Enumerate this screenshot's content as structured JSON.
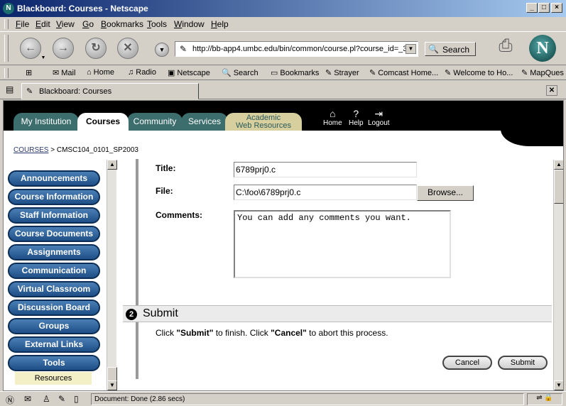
{
  "window": {
    "title": "Blackboard: Courses - Netscape",
    "app_icon": "N"
  },
  "menu": [
    "File",
    "Edit",
    "View",
    "Go",
    "Bookmarks",
    "Tools",
    "Window",
    "Help"
  ],
  "toolbar": {
    "url": "http://bb-app4.umbc.edu/bin/common/course.pl?course_id=_3",
    "search_label": "Search"
  },
  "personal_toolbar": [
    "Mail",
    "Home",
    "Radio",
    "Netscape",
    "Search",
    "Bookmarks",
    "Strayer",
    "Comcast Home...",
    "Welcome to Ho...",
    "MapQues"
  ],
  "tab": {
    "label": "Blackboard: Courses"
  },
  "bb": {
    "tabs": [
      "My Institution",
      "Courses",
      "Community",
      "Services",
      "Academic",
      "Web Resources"
    ],
    "header_icons": [
      "Home",
      "Help",
      "Logout"
    ],
    "breadcrumb_root": "COURSES",
    "breadcrumb_sep": ">",
    "breadcrumb_current": "CMSC104_0101_SP2003"
  },
  "leftnav": {
    "buttons": [
      "Announcements",
      "Course Information",
      "Staff Information",
      "Course Documents",
      "Assignments",
      "Communication",
      "Virtual Classroom",
      "Discussion Board",
      "Groups",
      "External Links",
      "Tools"
    ],
    "resources": "Resources"
  },
  "form": {
    "title_label": "Title:",
    "title_value": "6789prj0.c",
    "file_label": "File:",
    "file_value": "C:\\foo\\6789prj0.c",
    "browse": "Browse...",
    "comments_label": "Comments:",
    "comments_value": "You can add any comments you want.",
    "step_number": "2",
    "section_title": "Submit",
    "instr_pre": "Click ",
    "instr_submit": "\"Submit\"",
    "instr_mid": " to finish. Click ",
    "instr_cancel": "\"Cancel\"",
    "instr_post": " to abort this process.",
    "cancel": "Cancel",
    "submit": "Submit"
  },
  "status": {
    "message": "Document: Done (2.86 secs)"
  },
  "colors": {
    "titlebar": "#0a246a",
    "bb_tab": "#3d6e6e",
    "nav_button": "#1e4f86",
    "resources_bg": "#f3efc6"
  }
}
